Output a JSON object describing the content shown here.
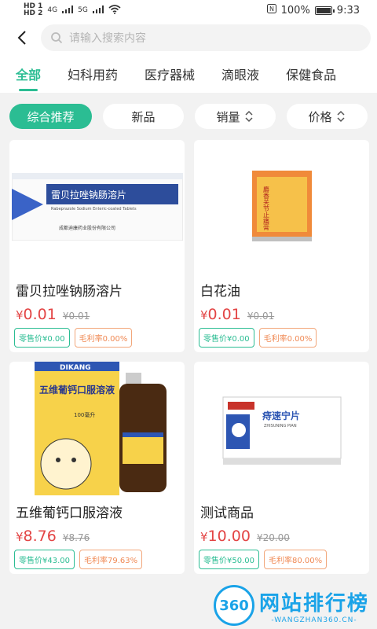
{
  "status": {
    "left_badges": [
      "HD 1",
      "HD 2"
    ],
    "network": [
      "4G",
      "5G"
    ],
    "battery": "100%",
    "time": "9:33"
  },
  "search": {
    "placeholder": "请输入搜索内容"
  },
  "tabs": [
    {
      "label": "全部",
      "active": true
    },
    {
      "label": "妇科用药"
    },
    {
      "label": "医疗器械"
    },
    {
      "label": "滴眼液"
    },
    {
      "label": "保健食品"
    }
  ],
  "filters": [
    {
      "label": "综合推荐",
      "active": true
    },
    {
      "label": "新品"
    },
    {
      "label": "销量",
      "sortable": true
    },
    {
      "label": "价格",
      "sortable": true
    }
  ],
  "products": [
    {
      "name": "雷贝拉唑钠肠溶片",
      "currency": "¥",
      "price": "0.01",
      "old_price": "¥0.01",
      "retail": "零售价¥0.00",
      "margin": "毛利率0.00%",
      "box_title": "雷贝拉唑钠肠溶片",
      "box_sub": "Rabeprazole Sodium Enteric-coated Tablets",
      "box_maker": "成都迪康药业股份有限公司"
    },
    {
      "name": "白花油",
      "currency": "¥",
      "price": "0.01",
      "old_price": "¥0.01",
      "retail": "零售价¥0.00",
      "margin": "毛利率0.00%",
      "box_title": "麝香关节止痛膏"
    },
    {
      "name": "五维葡钙口服溶液",
      "currency": "¥",
      "price": "8.76",
      "old_price": "¥8.76",
      "retail": "零售价¥43.00",
      "margin": "毛利率79.63%",
      "box_brand": "DIKANG",
      "box_title": "五维葡钙口服溶液",
      "box_vol": "100毫升"
    },
    {
      "name": "测试商品",
      "currency": "¥",
      "price": "10.00",
      "old_price": "¥20.00",
      "retail": "零售价¥50.00",
      "margin": "毛利率80.00%",
      "box_title": "痔速宁片",
      "box_sub": "ZHISUNING PIAN"
    }
  ],
  "watermark": {
    "logo": "360",
    "title": "网站排行榜",
    "url": "-WANGZHAN360.CN-"
  },
  "colors": {
    "accent": "#2bbd93",
    "price": "#e34545",
    "watermark": "#1aa3e8"
  }
}
